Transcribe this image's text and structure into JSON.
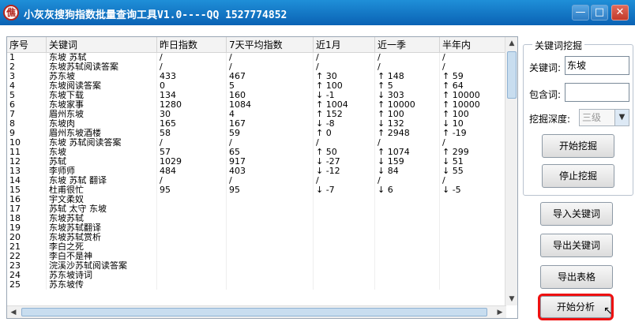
{
  "window": {
    "app_icon_glyph": "僬",
    "title": "小灰灰搜狗指数批量查询工具V1.0----QQ 1527774852",
    "minimize": "—",
    "maximize": "□",
    "close": "✕"
  },
  "table": {
    "headers": [
      "序号",
      "关键词",
      "昨日指数",
      "7天平均指数",
      "近1月",
      "近一季",
      "半年内"
    ],
    "rows": [
      [
        "1",
        "东坡 苏轼",
        "/",
        "/",
        "/",
        "/",
        "/"
      ],
      [
        "2",
        "东坡苏轼阅读答案",
        "/",
        "/",
        "/",
        "/",
        "/"
      ],
      [
        "3",
        "苏东坡",
        "433",
        "467",
        "↑ 30",
        "↑ 148",
        "↑ 59"
      ],
      [
        "4",
        "东坡阅读答案",
        "0",
        "5",
        "↑ 100",
        "↑ 5",
        "↑ 64"
      ],
      [
        "5",
        "东坡下载",
        "134",
        "160",
        "↓ -1",
        "↓ 303",
        "↑ 10000"
      ],
      [
        "6",
        "东坡家事",
        "1280",
        "1084",
        "↑ 1004",
        "↑ 10000",
        "↑ 10000"
      ],
      [
        "7",
        "眉州东坡",
        "30",
        "4",
        "↑ 152",
        "↑ 100",
        "↑ 100"
      ],
      [
        "8",
        "东坡肉",
        "165",
        "167",
        "↓ -8",
        "↓ 132",
        "↓ 10"
      ],
      [
        "9",
        "眉州东坡酒楼",
        "58",
        "59",
        "↑ 0",
        "↑ 2948",
        "↑ -19"
      ],
      [
        "10",
        "东坡 苏轼阅读答案",
        "/",
        "/",
        "/",
        "/",
        "/"
      ],
      [
        "11",
        "东坡",
        "57",
        "65",
        "↑ 50",
        "↑ 1074",
        "↑ 299"
      ],
      [
        "12",
        "苏轼",
        "1029",
        "917",
        "↓ -27",
        "↓ 159",
        "↓ 51"
      ],
      [
        "13",
        "李师师",
        "484",
        "403",
        "↓ -12",
        "↓ 84",
        "↓ 55"
      ],
      [
        "14",
        "东坡 苏轼 翻译",
        "/",
        "/",
        "/",
        "/",
        "/"
      ],
      [
        "15",
        "杜甫很忙",
        "95",
        "95",
        "↓ -7",
        "↓ 6",
        "↓ -5"
      ],
      [
        "16",
        "宇文柔奴",
        "",
        "",
        "",
        "",
        ""
      ],
      [
        "17",
        "苏轼 太守 东坡",
        "",
        "",
        "",
        "",
        ""
      ],
      [
        "18",
        "东坡苏轼",
        "",
        "",
        "",
        "",
        ""
      ],
      [
        "19",
        "东坡苏轼翻译",
        "",
        "",
        "",
        "",
        ""
      ],
      [
        "20",
        "东坡苏轼赏析",
        "",
        "",
        "",
        "",
        ""
      ],
      [
        "21",
        "李白之死",
        "",
        "",
        "",
        "",
        ""
      ],
      [
        "22",
        "李白不是神",
        "",
        "",
        "",
        "",
        ""
      ],
      [
        "23",
        "浣溪沙苏轼阅读答案",
        "",
        "",
        "",
        "",
        ""
      ],
      [
        "24",
        "苏东坡诗词",
        "",
        "",
        "",
        "",
        ""
      ],
      [
        "25",
        "苏东坡传",
        "",
        "",
        "",
        "",
        ""
      ]
    ]
  },
  "panel": {
    "group_title": "关键词挖掘",
    "keyword_label": "关键词:",
    "keyword_value": "东坡",
    "contains_label": "包含词:",
    "contains_value": "",
    "depth_label": "挖掘深度:",
    "depth_value": "三级",
    "start_mining": "开始挖掘",
    "stop_mining": "停止挖掘"
  },
  "buttons": {
    "import_keywords": "导入关键词",
    "export_keywords": "导出关键词",
    "export_table": "导出表格",
    "start_analysis": "开始分析"
  }
}
